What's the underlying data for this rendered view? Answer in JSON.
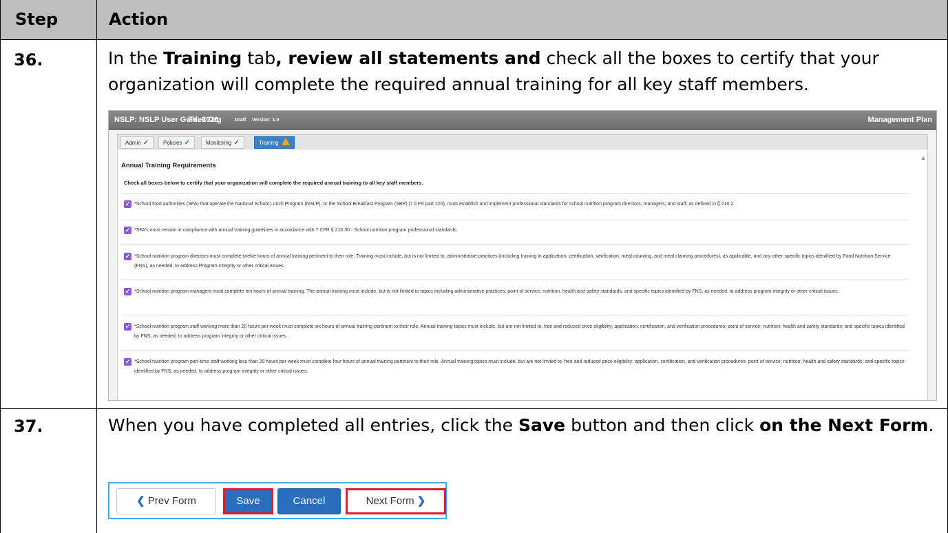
{
  "table": {
    "header_step": "Step",
    "header_action": "Action"
  },
  "step36": {
    "number": "36.",
    "text_1": "In the ",
    "bold_1": "Training",
    "text_2": " tab",
    "bold_2": ", review all statements and",
    "text_3": " check all the boxes to certify that your organization will complete the required annual training for all key staff members."
  },
  "screenshot1": {
    "title_org": "NSLP: NSLP User Guides Org",
    "title_fy": "FY: 2026",
    "status": "Draft",
    "version": "Version: 1.0",
    "right_title": "Management Plan",
    "tabs": [
      {
        "label": "Admin",
        "state": "complete"
      },
      {
        "label": "Policies",
        "state": "complete"
      },
      {
        "label": "Monitoring",
        "state": "complete"
      },
      {
        "label": "Training",
        "state": "warning"
      }
    ],
    "section_title": "Annual Training Requirements",
    "instruction": "Check all boxes below to certify that your organization will complete the required annual training to all key staff members.",
    "items": [
      "School food authorities (SFA) that operate the National School Lunch Program (NSLP), or the School Breakfast Program (SBP) (7 CFR part 220), must establish and implement professional standards for school nutrition program directors, managers, and staff, as defined in § 210.2.",
      "SFA's must remain in compliance with annual training guidelines in accordance with 7 CFR § 210.30 - School nutrition program professional standards.",
      "School nutrition program directors must complete twelve hours of annual training pertinent to their role. Training must include, but is not limited to, administrative practices (including training in application, certification, verification, meal counting, and meal claiming procedures), as applicable, and any other specific topics identified by Food Nutrition Service (FNS), as needed, to address Program integrity or other critical issues.",
      "School nutrition program managers must complete ten hours of annual training. The annual training must include, but is not limited to topics including administrative practices, point of service, nutrition, health and safety standards, and specific topics identified by FNS, as needed, to address program integrity or other critical issues.",
      "School nutrition program staff working more than 20 hours per week must complete six hours of annual training pertinent to their role. Annual training topics must include, but are not limited to, free and reduced price eligibility; application, certification, and verification procedures; point of service; nutrition; health and safety standards; and specific topics identified by FNS, as needed, to address program integrity or other critical issues.",
      "School nutrition program part-time staff working less than 20 hours per week must complete four hours of annual training pertinent to their role. Annual training topics must include, but are not limited to, free and reduced price eligibility; application, certification, and verification procedures; point of service; nutrition; health and safety standards; and specific topics identified by FNS, as needed, to address program integrity or other critical issues."
    ],
    "required_mark": "*",
    "check_glyph": "✓",
    "colors": {
      "checkbox": "#8a5cc9",
      "active_tab": "#3d7fc4",
      "warning": "#f2a516",
      "check": "#2e8b2e"
    }
  },
  "step37": {
    "number": "37.",
    "text_1": "When you have completed all entries, click the ",
    "bold_1": "Save",
    "text_2": " button and then click ",
    "bold_2": "on the Next Form",
    "text_3": "."
  },
  "screenshot2": {
    "prev_label": "Prev Form",
    "save_label": "Save",
    "cancel_label": "Cancel",
    "next_label": "Next Form",
    "prev_glyph": "❮",
    "next_glyph": "❯",
    "colors": {
      "highlight": "#e01c2d",
      "primary": "#2a6ebb",
      "frame": "#3fa9e0"
    }
  }
}
